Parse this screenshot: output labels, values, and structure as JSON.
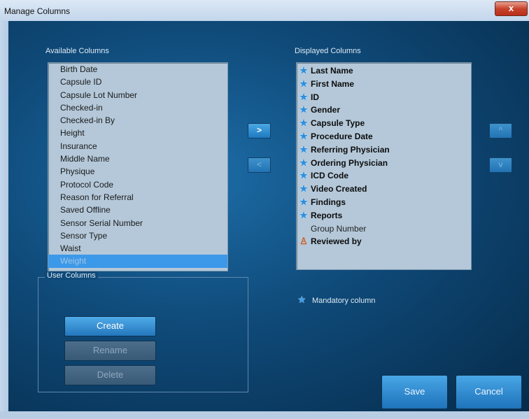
{
  "window": {
    "title": "Manage Columns",
    "close_label": "x"
  },
  "available": {
    "label": "Available Columns",
    "items": [
      "Birth Date",
      "Capsule ID",
      "Capsule Lot Number",
      "Checked-in",
      "Checked-in By",
      "Height",
      "Insurance",
      "Middle Name",
      "Physique",
      "Protocol Code",
      "Reason for Referral",
      "Saved Offline",
      "Sensor Serial Number",
      "Sensor Type",
      "Waist",
      "Weight"
    ],
    "selected_item": "Weight"
  },
  "move_buttons": {
    "add": ">",
    "remove": "<"
  },
  "order_buttons": {
    "up": "^",
    "down": "v"
  },
  "displayed": {
    "label": "Displayed Columns",
    "items": [
      {
        "label": "Last Name",
        "icon": "star-icon",
        "bold": true
      },
      {
        "label": "First Name",
        "icon": "star-icon",
        "bold": true
      },
      {
        "label": "ID",
        "icon": "star-icon",
        "bold": true
      },
      {
        "label": "Gender",
        "icon": "star-icon",
        "bold": true
      },
      {
        "label": "Capsule Type",
        "icon": "star-icon",
        "bold": true
      },
      {
        "label": "Procedure Date",
        "icon": "star-icon",
        "bold": true
      },
      {
        "label": "Referring Physician",
        "icon": "star-icon",
        "bold": true
      },
      {
        "label": "Ordering Physician",
        "icon": "star-icon",
        "bold": true
      },
      {
        "label": "ICD Code",
        "icon": "star-icon",
        "bold": true
      },
      {
        "label": "Video Created",
        "icon": "star-icon",
        "bold": true
      },
      {
        "label": "Findings",
        "icon": "star-icon",
        "bold": true
      },
      {
        "label": "Reports",
        "icon": "star-icon",
        "bold": true
      },
      {
        "label": "Group Number",
        "icon": "",
        "bold": false
      },
      {
        "label": "Reviewed by",
        "icon": "person-icon",
        "bold": true
      }
    ]
  },
  "legend": {
    "mandatory_label": "Mandatory column"
  },
  "user_columns": {
    "label": "User Columns",
    "create": "Create",
    "rename": "Rename",
    "delete": "Delete"
  },
  "actions": {
    "save": "Save",
    "cancel": "Cancel"
  }
}
